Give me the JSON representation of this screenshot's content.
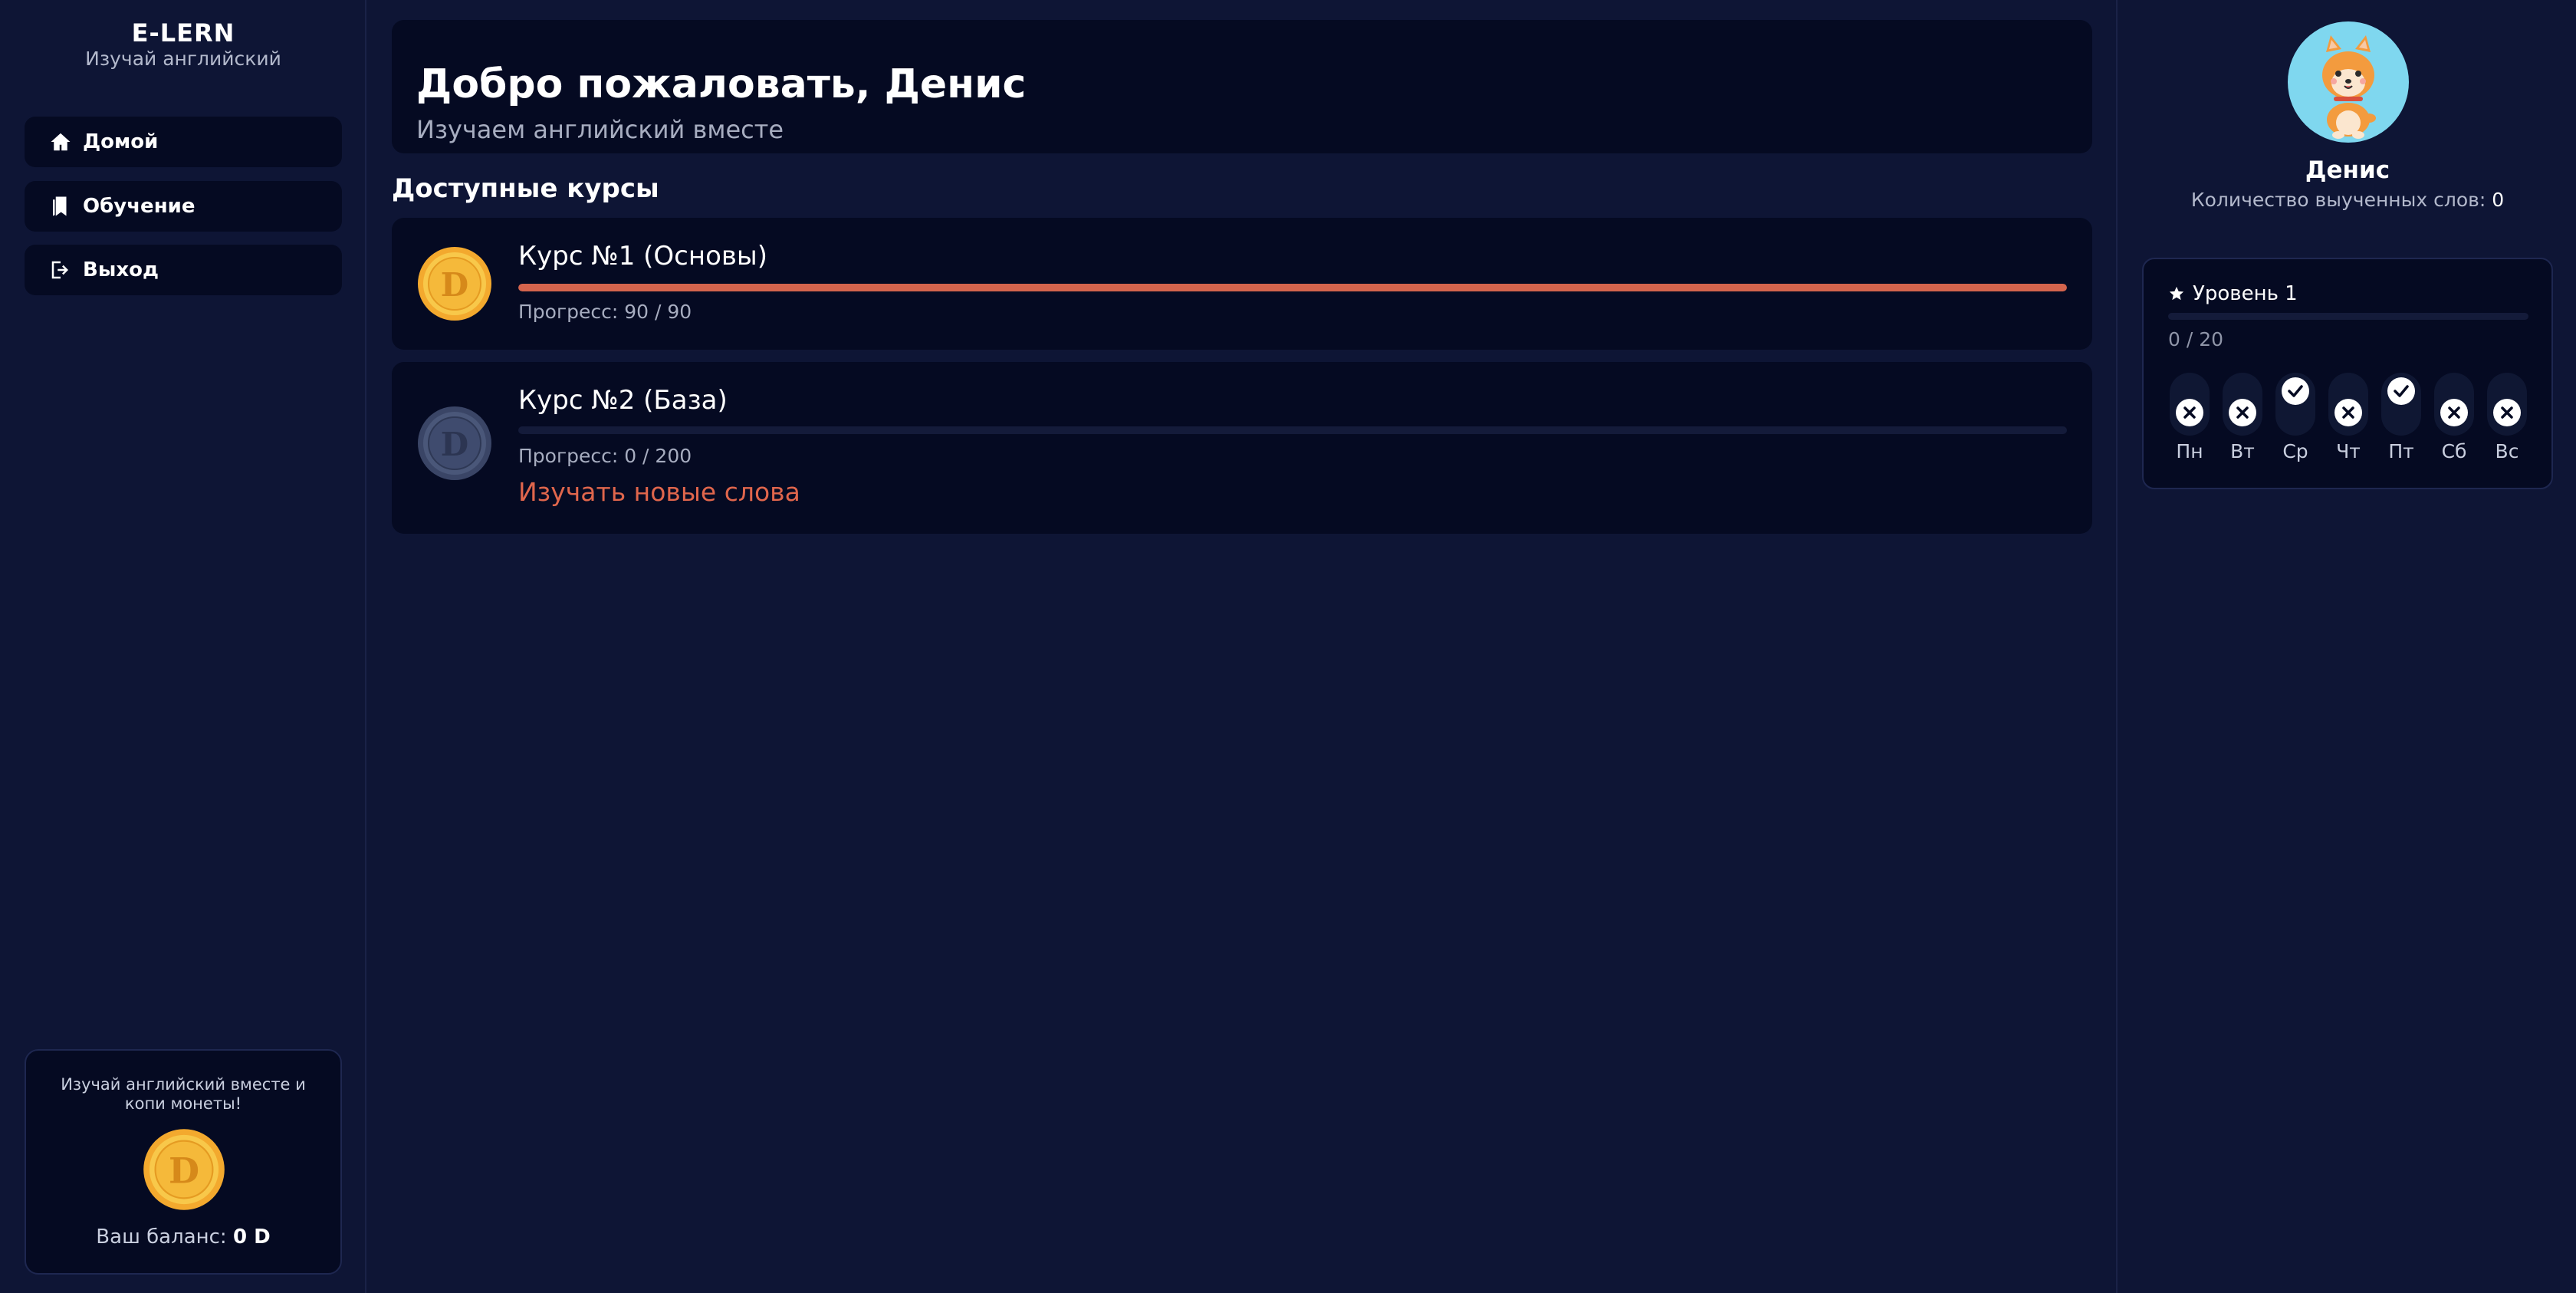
{
  "brand": {
    "title": "E-LERN",
    "subtitle": "Изучай английский"
  },
  "nav": [
    {
      "label": "Домой",
      "icon": "home-icon"
    },
    {
      "label": "Обучение",
      "icon": "bookmarks-icon"
    },
    {
      "label": "Выход",
      "icon": "logout-icon"
    }
  ],
  "promo": {
    "text": "Изучай английский вместе и копи монеты!",
    "balance_label": "Ваш баланс:",
    "balance_value": "0 D"
  },
  "welcome": {
    "title": "Добро пожаловать, Денис",
    "subtitle": "Изучаем английский вместе"
  },
  "courses_title": "Доступные курсы",
  "courses": [
    {
      "name": "Курс №1 (Основы)",
      "progress_text": "Прогресс: 90 / 90",
      "done": 90,
      "total": 90,
      "coin": "gold"
    },
    {
      "name": "Курс №2 (База)",
      "progress_text": "Прогресс: 0 / 200",
      "done": 0,
      "total": 200,
      "coin": "locked",
      "action": "Изучать новые слова"
    }
  ],
  "profile": {
    "name": "Денис",
    "words_label": "Количество выученных слов:",
    "words_value": "0",
    "avatar": "shiba-dog-avatar"
  },
  "level": {
    "title": "Уровень 1",
    "progress_text": "0 / 20",
    "done": 0,
    "total": 20,
    "days": [
      {
        "label": "Пн",
        "status": "missed"
      },
      {
        "label": "Вт",
        "status": "missed"
      },
      {
        "label": "Ср",
        "status": "done"
      },
      {
        "label": "Чт",
        "status": "missed"
      },
      {
        "label": "Пт",
        "status": "done"
      },
      {
        "label": "Сб",
        "status": "missed"
      },
      {
        "label": "Вс",
        "status": "missed"
      }
    ]
  },
  "colors": {
    "background": "#0e1535",
    "card": "#050a22",
    "accent": "#d4644d",
    "link": "#e0664c",
    "coin_gold": "#f5b93a",
    "avatar_bg": "#7fd7ef"
  }
}
